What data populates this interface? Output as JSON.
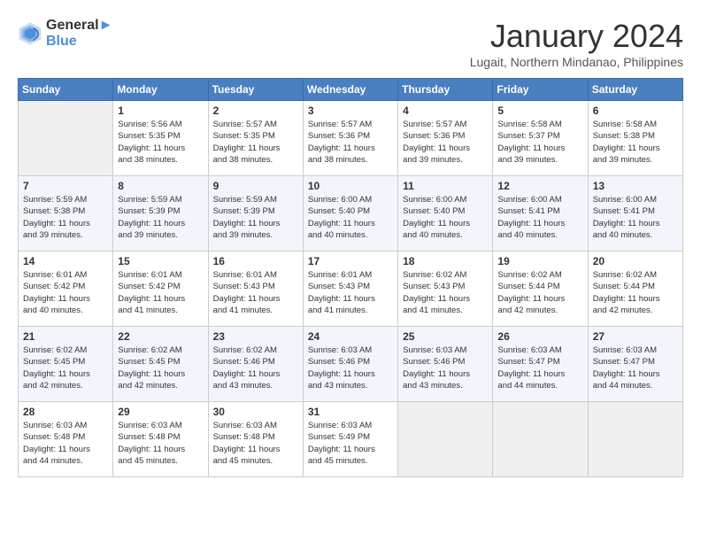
{
  "logo": {
    "line1": "General",
    "line2": "Blue"
  },
  "title": "January 2024",
  "location": "Lugait, Northern Mindanao, Philippines",
  "weekdays": [
    "Sunday",
    "Monday",
    "Tuesday",
    "Wednesday",
    "Thursday",
    "Friday",
    "Saturday"
  ],
  "weeks": [
    [
      {
        "day": "",
        "sunrise": "",
        "sunset": "",
        "daylight": ""
      },
      {
        "day": "1",
        "sunrise": "Sunrise: 5:56 AM",
        "sunset": "Sunset: 5:35 PM",
        "daylight": "Daylight: 11 hours and 38 minutes."
      },
      {
        "day": "2",
        "sunrise": "Sunrise: 5:57 AM",
        "sunset": "Sunset: 5:35 PM",
        "daylight": "Daylight: 11 hours and 38 minutes."
      },
      {
        "day": "3",
        "sunrise": "Sunrise: 5:57 AM",
        "sunset": "Sunset: 5:36 PM",
        "daylight": "Daylight: 11 hours and 38 minutes."
      },
      {
        "day": "4",
        "sunrise": "Sunrise: 5:57 AM",
        "sunset": "Sunset: 5:36 PM",
        "daylight": "Daylight: 11 hours and 39 minutes."
      },
      {
        "day": "5",
        "sunrise": "Sunrise: 5:58 AM",
        "sunset": "Sunset: 5:37 PM",
        "daylight": "Daylight: 11 hours and 39 minutes."
      },
      {
        "day": "6",
        "sunrise": "Sunrise: 5:58 AM",
        "sunset": "Sunset: 5:38 PM",
        "daylight": "Daylight: 11 hours and 39 minutes."
      }
    ],
    [
      {
        "day": "7",
        "sunrise": "Sunrise: 5:59 AM",
        "sunset": "Sunset: 5:38 PM",
        "daylight": "Daylight: 11 hours and 39 minutes."
      },
      {
        "day": "8",
        "sunrise": "Sunrise: 5:59 AM",
        "sunset": "Sunset: 5:39 PM",
        "daylight": "Daylight: 11 hours and 39 minutes."
      },
      {
        "day": "9",
        "sunrise": "Sunrise: 5:59 AM",
        "sunset": "Sunset: 5:39 PM",
        "daylight": "Daylight: 11 hours and 39 minutes."
      },
      {
        "day": "10",
        "sunrise": "Sunrise: 6:00 AM",
        "sunset": "Sunset: 5:40 PM",
        "daylight": "Daylight: 11 hours and 40 minutes."
      },
      {
        "day": "11",
        "sunrise": "Sunrise: 6:00 AM",
        "sunset": "Sunset: 5:40 PM",
        "daylight": "Daylight: 11 hours and 40 minutes."
      },
      {
        "day": "12",
        "sunrise": "Sunrise: 6:00 AM",
        "sunset": "Sunset: 5:41 PM",
        "daylight": "Daylight: 11 hours and 40 minutes."
      },
      {
        "day": "13",
        "sunrise": "Sunrise: 6:00 AM",
        "sunset": "Sunset: 5:41 PM",
        "daylight": "Daylight: 11 hours and 40 minutes."
      }
    ],
    [
      {
        "day": "14",
        "sunrise": "Sunrise: 6:01 AM",
        "sunset": "Sunset: 5:42 PM",
        "daylight": "Daylight: 11 hours and 40 minutes."
      },
      {
        "day": "15",
        "sunrise": "Sunrise: 6:01 AM",
        "sunset": "Sunset: 5:42 PM",
        "daylight": "Daylight: 11 hours and 41 minutes."
      },
      {
        "day": "16",
        "sunrise": "Sunrise: 6:01 AM",
        "sunset": "Sunset: 5:43 PM",
        "daylight": "Daylight: 11 hours and 41 minutes."
      },
      {
        "day": "17",
        "sunrise": "Sunrise: 6:01 AM",
        "sunset": "Sunset: 5:43 PM",
        "daylight": "Daylight: 11 hours and 41 minutes."
      },
      {
        "day": "18",
        "sunrise": "Sunrise: 6:02 AM",
        "sunset": "Sunset: 5:43 PM",
        "daylight": "Daylight: 11 hours and 41 minutes."
      },
      {
        "day": "19",
        "sunrise": "Sunrise: 6:02 AM",
        "sunset": "Sunset: 5:44 PM",
        "daylight": "Daylight: 11 hours and 42 minutes."
      },
      {
        "day": "20",
        "sunrise": "Sunrise: 6:02 AM",
        "sunset": "Sunset: 5:44 PM",
        "daylight": "Daylight: 11 hours and 42 minutes."
      }
    ],
    [
      {
        "day": "21",
        "sunrise": "Sunrise: 6:02 AM",
        "sunset": "Sunset: 5:45 PM",
        "daylight": "Daylight: 11 hours and 42 minutes."
      },
      {
        "day": "22",
        "sunrise": "Sunrise: 6:02 AM",
        "sunset": "Sunset: 5:45 PM",
        "daylight": "Daylight: 11 hours and 42 minutes."
      },
      {
        "day": "23",
        "sunrise": "Sunrise: 6:02 AM",
        "sunset": "Sunset: 5:46 PM",
        "daylight": "Daylight: 11 hours and 43 minutes."
      },
      {
        "day": "24",
        "sunrise": "Sunrise: 6:03 AM",
        "sunset": "Sunset: 5:46 PM",
        "daylight": "Daylight: 11 hours and 43 minutes."
      },
      {
        "day": "25",
        "sunrise": "Sunrise: 6:03 AM",
        "sunset": "Sunset: 5:46 PM",
        "daylight": "Daylight: 11 hours and 43 minutes."
      },
      {
        "day": "26",
        "sunrise": "Sunrise: 6:03 AM",
        "sunset": "Sunset: 5:47 PM",
        "daylight": "Daylight: 11 hours and 44 minutes."
      },
      {
        "day": "27",
        "sunrise": "Sunrise: 6:03 AM",
        "sunset": "Sunset: 5:47 PM",
        "daylight": "Daylight: 11 hours and 44 minutes."
      }
    ],
    [
      {
        "day": "28",
        "sunrise": "Sunrise: 6:03 AM",
        "sunset": "Sunset: 5:48 PM",
        "daylight": "Daylight: 11 hours and 44 minutes."
      },
      {
        "day": "29",
        "sunrise": "Sunrise: 6:03 AM",
        "sunset": "Sunset: 5:48 PM",
        "daylight": "Daylight: 11 hours and 45 minutes."
      },
      {
        "day": "30",
        "sunrise": "Sunrise: 6:03 AM",
        "sunset": "Sunset: 5:48 PM",
        "daylight": "Daylight: 11 hours and 45 minutes."
      },
      {
        "day": "31",
        "sunrise": "Sunrise: 6:03 AM",
        "sunset": "Sunset: 5:49 PM",
        "daylight": "Daylight: 11 hours and 45 minutes."
      },
      {
        "day": "",
        "sunrise": "",
        "sunset": "",
        "daylight": ""
      },
      {
        "day": "",
        "sunrise": "",
        "sunset": "",
        "daylight": ""
      },
      {
        "day": "",
        "sunrise": "",
        "sunset": "",
        "daylight": ""
      }
    ]
  ]
}
